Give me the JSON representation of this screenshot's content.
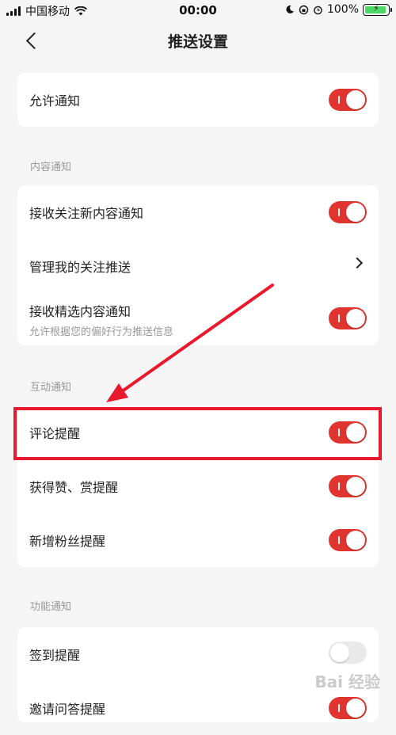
{
  "status_bar": {
    "carrier": "中国移动",
    "time": "00:00",
    "battery": "100%"
  },
  "header": {
    "title": "推送设置",
    "back_icon": "chevron-left-icon"
  },
  "sections": [
    {
      "title": "",
      "items": [
        {
          "label": "允许通知",
          "control": "toggle",
          "on": true
        }
      ]
    },
    {
      "title": "内容通知",
      "items": [
        {
          "label": "接收关注新内容通知",
          "control": "toggle",
          "on": true
        },
        {
          "label": "管理我的关注推送",
          "control": "chevron"
        },
        {
          "label": "接收精选内容通知",
          "sub": "允许根据您的偏好行为推送信息",
          "control": "toggle",
          "on": true
        }
      ]
    },
    {
      "title": "互动通知",
      "items": [
        {
          "label": "评论提醒",
          "control": "toggle",
          "on": true
        },
        {
          "label": "获得赞、赏提醒",
          "control": "toggle",
          "on": true
        },
        {
          "label": "新增粉丝提醒",
          "control": "toggle",
          "on": true
        }
      ]
    },
    {
      "title": "功能通知",
      "items": [
        {
          "label": "签到提醒",
          "control": "toggle",
          "on": false
        },
        {
          "label": "邀请问答提醒",
          "control": "toggle",
          "on": true
        }
      ]
    }
  ],
  "colors": {
    "accent": "#e0342f",
    "highlight": "#e8192c",
    "background": "#f5f5f5"
  },
  "watermark": "Bai 经验"
}
